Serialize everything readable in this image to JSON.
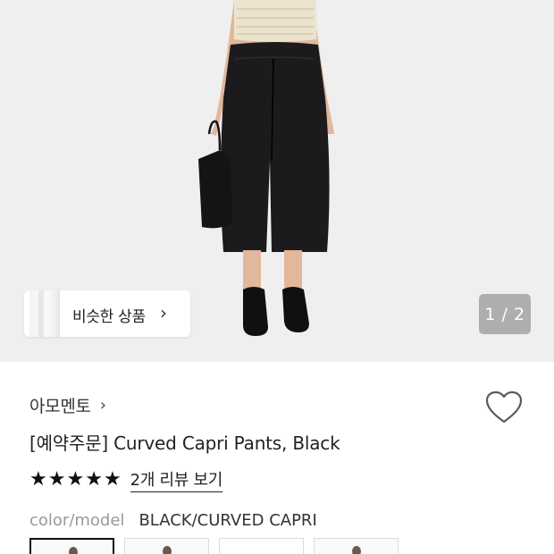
{
  "gallery": {
    "similar_button_label": "비슷한 상품",
    "similar_chevron": "›",
    "pager_text": "1 / 2"
  },
  "product": {
    "brand": "아모멘토",
    "brand_chevron": "›",
    "title": "[예약주문] Curved Capri Pants, Black",
    "rating_stars": 5,
    "stars": [
      "★",
      "★",
      "★",
      "★",
      "★"
    ],
    "review_link_label": "2개 리뷰 보기",
    "spec_key": "color/model",
    "spec_value": "BLACK/CURVED CAPRI",
    "wishlisted": false
  },
  "variants": [
    {
      "selected": true
    },
    {
      "selected": false
    },
    {
      "selected": false
    },
    {
      "selected": false
    }
  ],
  "icons": {
    "heart": "heart-outline-icon",
    "chevron": "chevron-right-icon",
    "star": "star-filled-icon"
  },
  "colors": {
    "hero_background": "#efefef",
    "pants": "#1b1b1d",
    "top": "#ece3cf",
    "skin": "#e2b79c",
    "text_primary": "#222222",
    "text_muted": "#999999"
  }
}
